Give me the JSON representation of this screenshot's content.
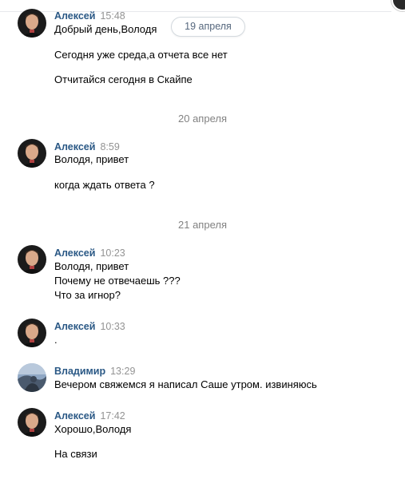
{
  "date_badge": "19 апреля",
  "separators": {
    "apr20": "20 апреля",
    "apr21": "21 апреля"
  },
  "groups": [
    {
      "author": "Алексей",
      "time": "15:48",
      "lines": [
        "Добрый день,Володя",
        "Сегодня уже среда,а отчета все нет",
        "Отчитайся сегодня в Скайпе"
      ]
    },
    {
      "author": "Алексей",
      "time": "8:59",
      "lines": [
        "Володя, привет",
        "когда ждать ответа ?"
      ]
    },
    {
      "author": "Алексей",
      "time": "10:23",
      "lines": [
        "Володя, привет",
        "Почему не отвечаешь ???",
        "Что за игнор?"
      ]
    },
    {
      "author": "Алексей",
      "time": "10:33",
      "lines": [
        "."
      ]
    },
    {
      "author": "Владимир",
      "time": "13:29",
      "lines": [
        "Вечером свяжемся я написал Саше утром. извиняюсь"
      ]
    },
    {
      "author": "Алексей",
      "time": "17:42",
      "lines": [
        "Хорошо,Володя",
        "На связи"
      ]
    }
  ]
}
